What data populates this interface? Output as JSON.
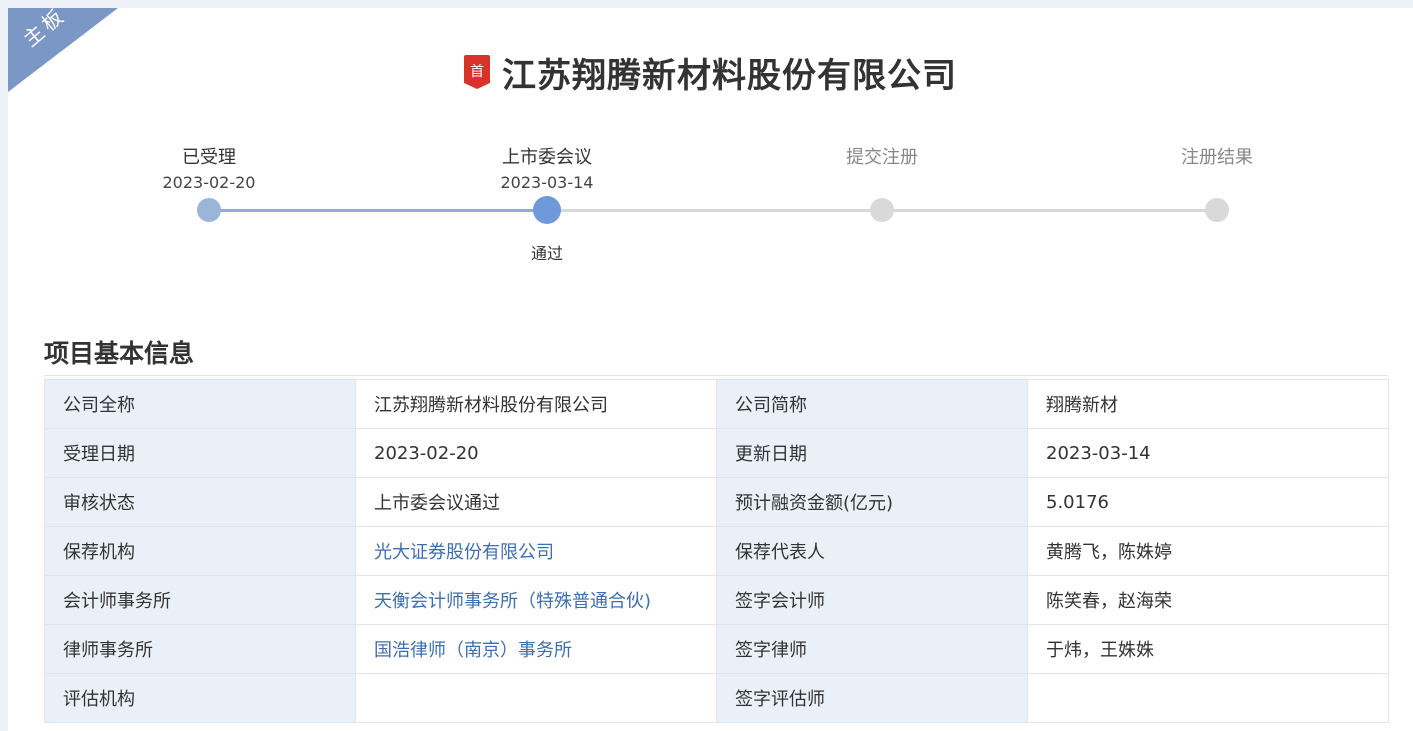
{
  "ribbon": {
    "text": "主板"
  },
  "header": {
    "badge": "首",
    "company_name": "江苏翔腾新材料股份有限公司"
  },
  "colors": {
    "accent": "#6f99d8",
    "badge_red": "#d9322b",
    "link": "#3d6fb0",
    "ribbon": "#7a97c6"
  },
  "progress": {
    "steps": [
      {
        "label": "已受理",
        "date": "2023-02-20",
        "state": "done"
      },
      {
        "label": "上市委会议",
        "date": "2023-03-14",
        "state": "current",
        "status": "通过"
      },
      {
        "label": "提交注册",
        "date": "",
        "state": "pending"
      },
      {
        "label": "注册结果",
        "date": "",
        "state": "pending"
      }
    ]
  },
  "section": {
    "title": "项目基本信息"
  },
  "info_table": {
    "rows": [
      {
        "k1": "公司全称",
        "v1": "江苏翔腾新材料股份有限公司",
        "k2": "公司简称",
        "v2": "翔腾新材"
      },
      {
        "k1": "受理日期",
        "v1": "2023-02-20",
        "k2": "更新日期",
        "v2": "2023-03-14"
      },
      {
        "k1": "审核状态",
        "v1": "上市委会议通过",
        "k2": "预计融资金额(亿元)",
        "v2": "5.0176"
      },
      {
        "k1": "保荐机构",
        "v1": "光大证券股份有限公司",
        "k2": "保荐代表人",
        "v2": "黄腾飞，陈姝婷"
      },
      {
        "k1": "会计师事务所",
        "v1": "天衡会计师事务所（特殊普通合伙)",
        "k2": "签字会计师",
        "v2": "陈笑春，赵海荣"
      },
      {
        "k1": "律师事务所",
        "v1": "国浩律师（南京）事务所",
        "k2": "签字律师",
        "v2": "于炜，王姝姝"
      },
      {
        "k1": "评估机构",
        "v1": "",
        "k2": "签字评估师",
        "v2": ""
      }
    ]
  }
}
